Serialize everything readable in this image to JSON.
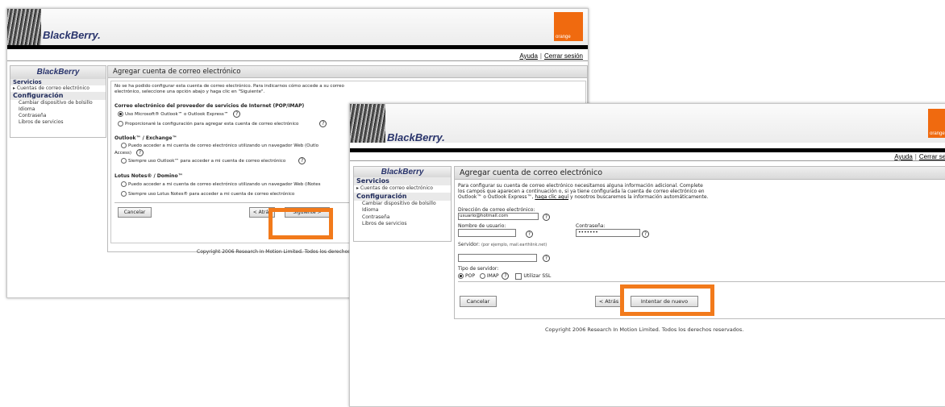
{
  "brand": {
    "logo_text": "BlackBerry.",
    "operator": "orange",
    "sidebar_logo": "BlackBerry"
  },
  "colors": {
    "highlight": "#f27a1b",
    "operator_orange": "#f06a0f",
    "brand_navy": "#28336b"
  },
  "toplinks": {
    "help": "Ayuda",
    "logout": "Cerrar sesión",
    "logout_cut": "Cerrar sesi"
  },
  "sidebar": {
    "services_head": "Servicios",
    "accounts_item": "Cuentas de correo electrónico",
    "config_head": "Configuración",
    "items": [
      "Cambiar dispositivo de bolsillo",
      "Idioma",
      "Contraseña",
      "Libros de servicios"
    ]
  },
  "window_a": {
    "title": "Agregar cuenta de correo electrónico",
    "intro_1": "No se ha podido configurar esta cuenta de correo electrónico. Para indicarnos cómo accede a su correo",
    "intro_2": "electrónico, seleccione una opción abajo y haga clic en \"Siguiente\".",
    "isp_heading": "Correo electrónico del proveedor de servicios de Internet (POP/IMAP)",
    "isp_opt1": "Uso Microsoft® Outlook™ o Outlook Express™",
    "isp_opt2": "Proporcionaré la configuración para agregar esta cuenta de correo electrónico",
    "exchange_heading": "Outlook™ / Exchange™",
    "exchange_opt1": "Puedo acceder a mi cuenta de correo electrónico utilizando un navegador Web (Outlo",
    "exchange_opt1b": "Access)",
    "exchange_opt2": "Siempre uso Outlook™ para acceder a mi cuenta de correo electrónico",
    "lotus_heading": "Lotus Notes® / Domino™",
    "lotus_opt1": "Puedo acceder a mi cuenta de correo electrónico utilizando un navegador Web (iNotes",
    "lotus_opt2": "Siempre uso Lotus Notes® para acceder a mi cuenta de correo electrónico",
    "cancel": "Cancelar",
    "back": "< Atrás",
    "next": "Siguiente >",
    "copyright": "Copyright 2006 Research In Motion Limited. Todos los derechos"
  },
  "window_b": {
    "title": "Agregar cuenta de correo electrónico",
    "intro_1": "Para configurar su cuenta de correo electrónico necesitamos alguna información adicional. Complete",
    "intro_2": "los campos que aparecen a continuación o, si ya tiene configurada la cuenta de correo electrónico en",
    "intro_3a": "Outlook™ o Outlook Express™,",
    "intro_link": "haga clic aquí",
    "intro_3b": "y nosotros buscaremos la información automáticamente.",
    "email_label": "Dirección de correo electrónico:",
    "email_value": "usuario@hotmail.com",
    "user_label": "Nombre de usuario:",
    "user_value": "",
    "pass_label": "Contraseña:",
    "pass_value": "•••••••",
    "server_label": "Servidor:",
    "server_hint": "(por ejemplo, mail.earthlink.net)",
    "server_value": "",
    "type_label": "Tipo de servidor:",
    "type_pop": "POP",
    "type_imap": "IMAP",
    "ssl_label": "Utilizar SSL",
    "cancel": "Cancelar",
    "back": "< Atrás",
    "retry": "Intentar de nuevo",
    "copyright": "Copyright 2006 Research In Motion Limited. Todos los derechos reservados."
  },
  "help_glyph": "?"
}
